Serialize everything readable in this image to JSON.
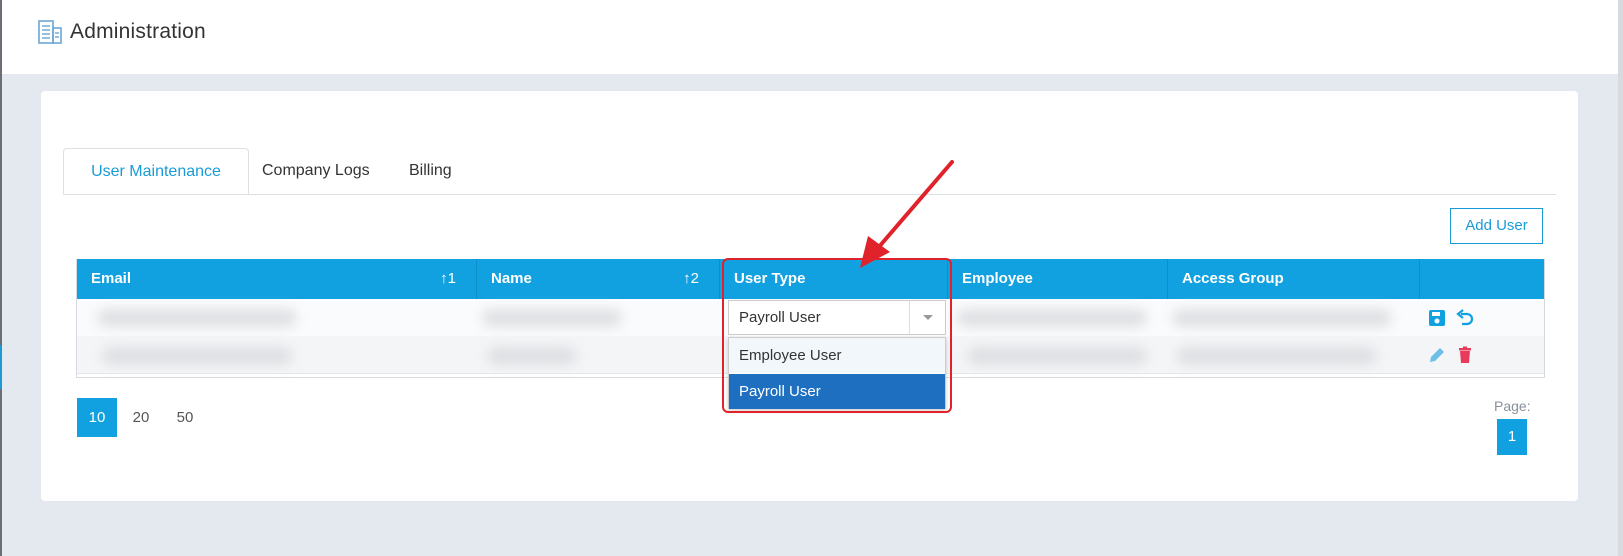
{
  "header": {
    "title": "Administration",
    "icon": "building-icon"
  },
  "tabs": [
    {
      "label": "User Maintenance",
      "active": true
    },
    {
      "label": "Company Logs",
      "active": false
    },
    {
      "label": "Billing",
      "active": false
    }
  ],
  "toolbar": {
    "add_user_label": "Add User"
  },
  "grid": {
    "columns": [
      {
        "label": "Email",
        "sort": "1"
      },
      {
        "label": "Name",
        "sort": "2"
      },
      {
        "label": "User Type"
      },
      {
        "label": "Employee"
      },
      {
        "label": "Access Group"
      },
      {
        "label": ""
      }
    ],
    "edit_row": {
      "user_type_value": "Payroll User",
      "dropdown_options": [
        "Employee User",
        "Payroll User"
      ],
      "selected_option": "Payroll User",
      "actions": [
        "save-icon",
        "undo-icon"
      ]
    },
    "row2_actions": [
      "edit-icon",
      "delete-icon"
    ]
  },
  "pagination": {
    "page_sizes": [
      "10",
      "20",
      "50"
    ],
    "active_size": "10",
    "page_label": "Page:",
    "current_page": "1"
  },
  "colors": {
    "accent": "#12a1e0",
    "highlight": "#e0222a",
    "selected_option": "#1f6fc1",
    "delete": "#ea3a5c"
  }
}
